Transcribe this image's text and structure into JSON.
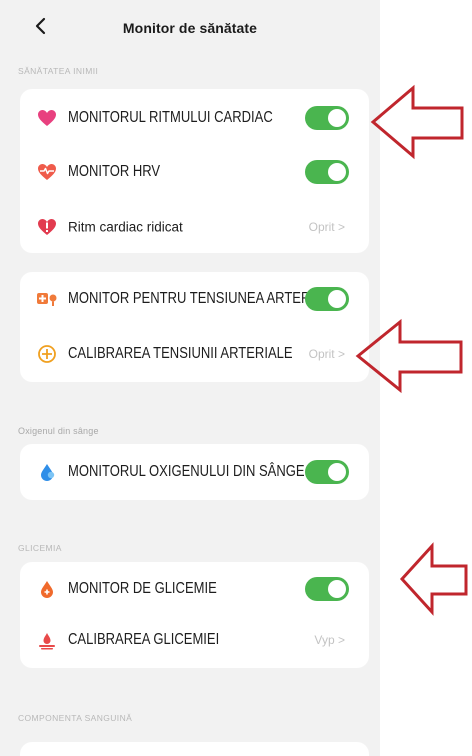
{
  "header": {
    "title": "Monitor de sănătate",
    "back_icon": "chevron-left-icon"
  },
  "sections": {
    "heart": {
      "label": "SĂNĂTATEA INIMII",
      "items": [
        {
          "label": "MONITORUL RITMULUI CARDIAC",
          "icon": "heart-icon",
          "icon_color": "#e8407f",
          "toggle": true
        },
        {
          "label": "MONITOR HRV",
          "icon": "heart-pulse-icon",
          "icon_color": "#ef5b4b",
          "toggle": true
        },
        {
          "label": "Ritm cardiac ridicat",
          "icon": "heart-alert-icon",
          "icon_color": "#e23b4f",
          "status": "Oprit >"
        }
      ]
    },
    "blood_pressure": {
      "items": [
        {
          "label": "MONITOR PENTRU TENSIUNEA ARTERIALĂ",
          "icon": "blood-pressure-icon",
          "icon_color": "#f07a3a",
          "toggle": true
        },
        {
          "label": "CALIBRAREA TENSIUNII ARTERIALE",
          "icon": "calibrate-icon",
          "icon_color": "#f0a020",
          "status": "Oprit >"
        }
      ]
    },
    "oxygen": {
      "label": "Oxigenul din sânge",
      "items": [
        {
          "label": "MONITORUL OXIGENULUI DIN SÂNGE",
          "icon": "drop-icon",
          "icon_color": "#2f8ee8",
          "toggle": true
        }
      ]
    },
    "glucose": {
      "label": "GLICEMIA",
      "items": [
        {
          "label": "MONITOR DE GLICEMIE",
          "icon": "glucose-drop-icon",
          "icon_color": "#f06a2c",
          "toggle": true
        },
        {
          "label": "CALIBRAREA GLICEMIEI",
          "icon": "glucose-calibrate-icon",
          "icon_color": "#e84a4a",
          "status": "Vyp >"
        }
      ]
    },
    "blood_components": {
      "label": "COMPONENTA SANGUINĂ"
    }
  },
  "colors": {
    "toggle_on": "#4ab54f",
    "arrow": "#c0262d",
    "background": "#f2f2f2"
  }
}
